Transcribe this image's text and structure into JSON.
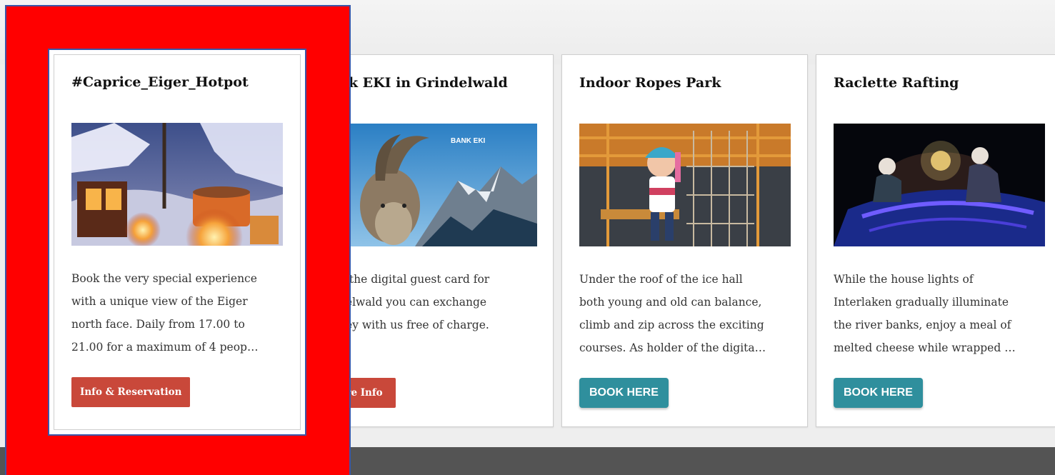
{
  "colors": {
    "highlight": "#ff0000",
    "highlight_border": "#3a56a8",
    "red_button": "#c9483a",
    "teal_button": "#2f8f9d",
    "footer": "#545454"
  },
  "cards": [
    {
      "title": "#Caprice_Eiger_Hotpot",
      "image_icon": "hotpot-photo",
      "text_lines": [
        "Book the very special experience",
        "with a unique view of the Eiger",
        "north face. Daily from 17.00 to",
        "21.00 for a maximum of 4 peop…"
      ],
      "button": "Info & Reservation"
    },
    {
      "title": "nk EKI in Grindelwald",
      "image_icon": "ibex-bank-photo",
      "image_text": "BANK EKI",
      "text_lines": [
        "n the digital guest card for",
        "delwald you can exchange",
        "hey with us free of charge."
      ],
      "button": "re Info"
    },
    {
      "title": "Indoor Ropes Park",
      "image_icon": "ropes-park-photo",
      "text_lines": [
        "Under the roof of the ice hall",
        "both young and old can balance,",
        "climb and zip across the exciting",
        "courses. As holder of the digita…"
      ],
      "button": "BOOK HERE"
    },
    {
      "title": "Raclette Rafting",
      "image_icon": "raclette-rafting-photo",
      "text_lines": [
        "While the house lights of",
        "Interlaken gradually illuminate",
        "the river banks, enjoy a meal of",
        "melted cheese while wrapped …"
      ],
      "button": "BOOK HERE"
    }
  ]
}
